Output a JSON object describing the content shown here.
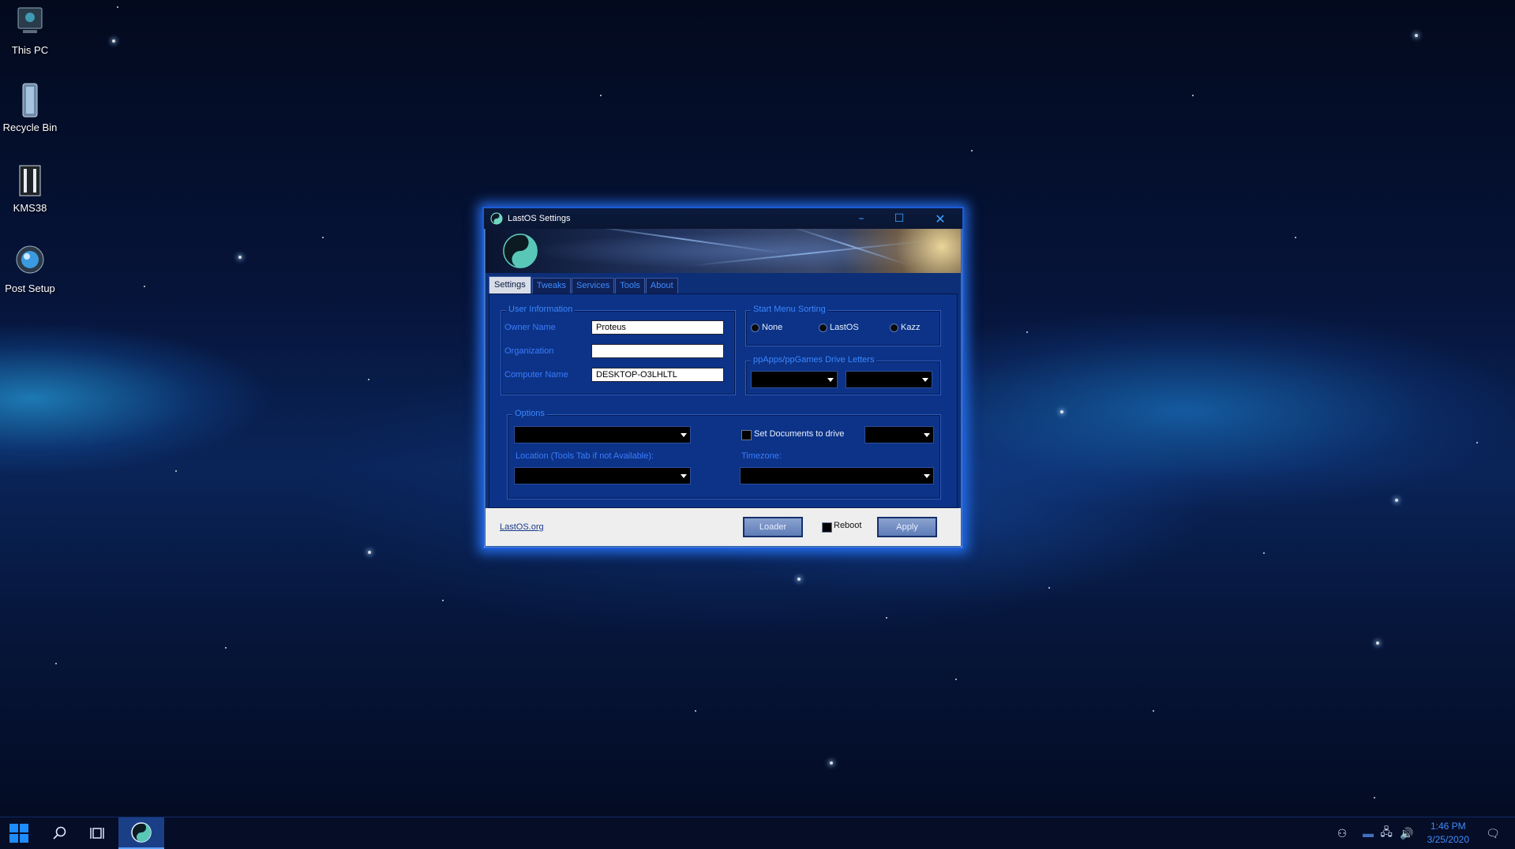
{
  "desktop": {
    "icons": [
      {
        "label": "This PC",
        "icon": "monitor-icon"
      },
      {
        "label": "Recycle Bin",
        "icon": "recycle-bin-icon"
      },
      {
        "label": "KMS38",
        "icon": "kms38-icon"
      },
      {
        "label": "Post Setup",
        "icon": "post-setup-icon"
      }
    ]
  },
  "window": {
    "title": "LastOS Settings",
    "controls": {
      "minimize": "–",
      "maximize": "☐",
      "close": "✕"
    },
    "tabs": [
      "Settings",
      "Tweaks",
      "Services",
      "Tools",
      "About"
    ],
    "active_tab": "Settings",
    "user_information": {
      "title": "User Information",
      "owner_name_label": "Owner Name",
      "owner_name_value": "Proteus",
      "organization_label": "Organization",
      "organization_value": "",
      "computer_name_label": "Computer Name",
      "computer_name_value": "DESKTOP-O3LHLTL"
    },
    "start_menu_sorting": {
      "title": "Start Menu Sorting",
      "options": [
        "None",
        "LastOS",
        "Kazz"
      ]
    },
    "drive_letters": {
      "title": "ppApps/ppGames Drive Letters"
    },
    "options": {
      "title": "Options",
      "set_documents_label": "Set Documents to drive",
      "location_label": "Location (Tools Tab if not Available):",
      "timezone_label": "Timezone:"
    },
    "footer": {
      "link": "LastOS.org",
      "loader_button": "Loader",
      "reboot_label": "Reboot",
      "apply_button": "Apply"
    }
  },
  "taskbar": {
    "clock_time": "1:46 PM",
    "clock_date": "3/25/2020"
  },
  "colors": {
    "accent": "#1d5ad8",
    "panel": "#0c3387",
    "label_blue": "#3a7cff",
    "clock": "#3f8cff"
  }
}
